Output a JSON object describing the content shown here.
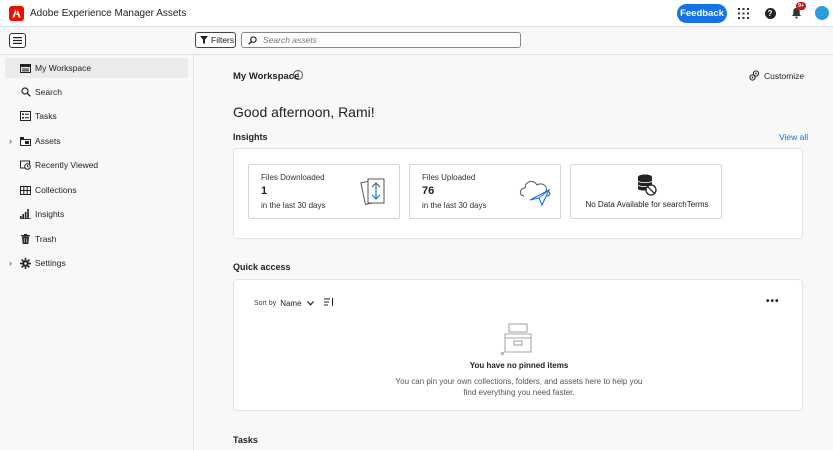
{
  "app": {
    "title": "Adobe Experience Manager Assets"
  },
  "topbar": {
    "feedback_label": "Feedback",
    "notification_count": "9+",
    "help_label": "?"
  },
  "toolbar": {
    "filters_label": "Filters",
    "search_placeholder": "Search assets"
  },
  "sidebar": {
    "items": [
      {
        "label": "My Workspace",
        "icon": "workspace-icon",
        "active": true,
        "expandable": false
      },
      {
        "label": "Search",
        "icon": "search-icon",
        "active": false,
        "expandable": false
      },
      {
        "label": "Tasks",
        "icon": "tasks-icon",
        "active": false,
        "expandable": false
      },
      {
        "label": "Assets",
        "icon": "assets-icon",
        "active": false,
        "expandable": true
      },
      {
        "label": "Recently Viewed",
        "icon": "recently-viewed-icon",
        "active": false,
        "expandable": false
      },
      {
        "label": "Collections",
        "icon": "collections-icon",
        "active": false,
        "expandable": false
      },
      {
        "label": "Insights",
        "icon": "insights-icon",
        "active": false,
        "expandable": false
      },
      {
        "label": "Trash",
        "icon": "trash-icon",
        "active": false,
        "expandable": false
      },
      {
        "label": "Settings",
        "icon": "gear-icon",
        "active": false,
        "expandable": true
      }
    ]
  },
  "main": {
    "title": "My Workspace",
    "info_label": "i",
    "customize_label": "Customize",
    "greeting": "Good afternoon, Rami!",
    "insights": {
      "title": "Insights",
      "view_all": "View all",
      "cards": [
        {
          "title": "Files Downloaded",
          "value": "1",
          "sub": "in the last 30 days"
        },
        {
          "title": "Files Uploaded",
          "value": "76",
          "sub": "in the last 30 days"
        },
        {
          "nodata": "No Data Available for searchTerms"
        }
      ]
    },
    "quick_access": {
      "title": "Quick access",
      "sort_by_label": "Sort by",
      "sort_value": "Name",
      "more_label": "•••",
      "empty_title": "You have no pinned items",
      "empty_desc": "You can pin your own collections, folders, and assets here to help you find everything you need faster."
    },
    "tasks_title": "Tasks"
  },
  "colors": {
    "accent": "#1473e6",
    "brand": "#eb1000",
    "notification": "#d31510",
    "avatar": "#2d9cdb"
  }
}
